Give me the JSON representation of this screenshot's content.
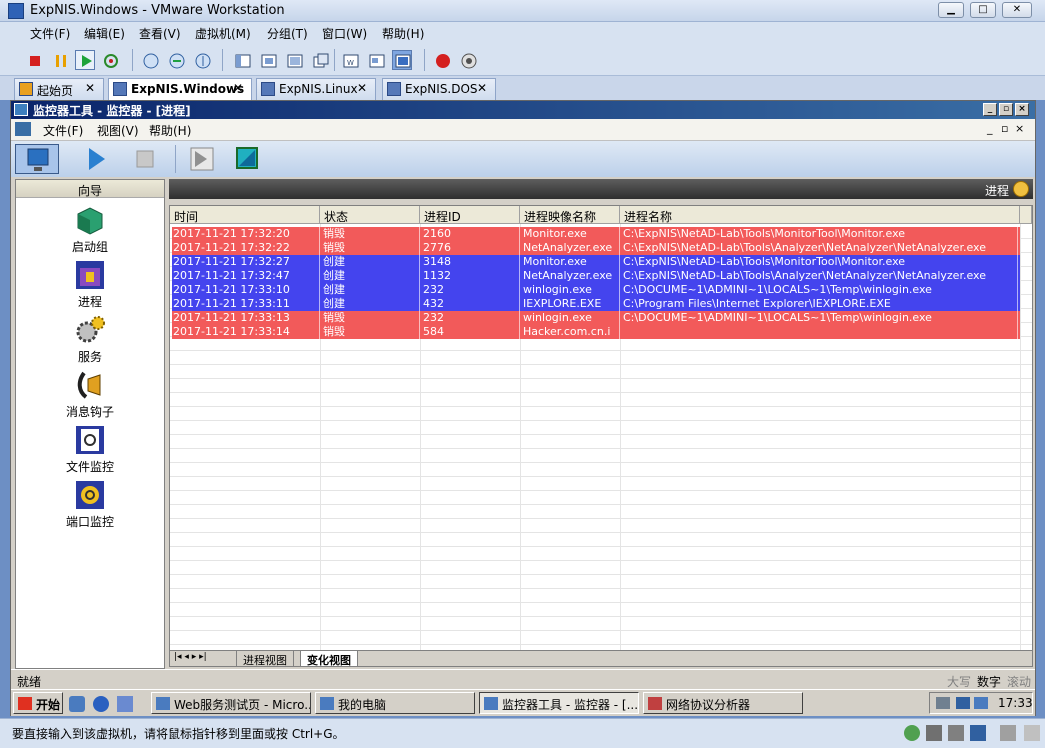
{
  "vm": {
    "title": "ExpNIS.Windows - VMware Workstation",
    "menu": [
      "文件(F)",
      "编辑(E)",
      "查看(V)",
      "虚拟机(M)",
      "分组(T)",
      "窗口(W)",
      "帮助(H)"
    ],
    "tabs": [
      {
        "label": "起始页",
        "active": false
      },
      {
        "label": "ExpNIS.Windows",
        "active": true
      },
      {
        "label": "ExpNIS.Linux",
        "active": false
      },
      {
        "label": "ExpNIS.DOS",
        "active": false
      }
    ],
    "status": "要直接输入到该虚拟机，请将鼠标指针移到里面或按 Ctrl+G。"
  },
  "app": {
    "title": "监控器工具 - 监控器 - [进程]",
    "menu": [
      "文件(F)",
      "视图(V)",
      "帮助(H)"
    ],
    "sidebar": {
      "header": "向导",
      "items": [
        "启动组",
        "进程",
        "服务",
        "消息钩子",
        "文件监控",
        "端口监控"
      ]
    },
    "panel_title": "进程",
    "columns": [
      "时间",
      "状态",
      "进程ID",
      "进程映像名称",
      "进程名称"
    ],
    "rows": [
      {
        "color": "r",
        "time": "2017-11-21 17:32:20",
        "status": "销毁",
        "pid": "2160",
        "image": "Monitor.exe",
        "path": "C:\\ExpNIS\\NetAD-Lab\\Tools\\MonitorTool\\Monitor.exe"
      },
      {
        "color": "r",
        "time": "2017-11-21 17:32:22",
        "status": "销毁",
        "pid": "2776",
        "image": "NetAnalyzer.exe",
        "path": "C:\\ExpNIS\\NetAD-Lab\\Tools\\Analyzer\\NetAnalyzer\\NetAnalyzer.exe"
      },
      {
        "color": "b",
        "time": "2017-11-21 17:32:27",
        "status": "创建",
        "pid": "3148",
        "image": "Monitor.exe",
        "path": "C:\\ExpNIS\\NetAD-Lab\\Tools\\MonitorTool\\Monitor.exe"
      },
      {
        "color": "b",
        "time": "2017-11-21 17:32:47",
        "status": "创建",
        "pid": "1132",
        "image": "NetAnalyzer.exe",
        "path": "C:\\ExpNIS\\NetAD-Lab\\Tools\\Analyzer\\NetAnalyzer\\NetAnalyzer.exe"
      },
      {
        "color": "b",
        "time": "2017-11-21 17:33:10",
        "status": "创建",
        "pid": "232",
        "image": "winlogin.exe",
        "path": "C:\\DOCUME~1\\ADMINI~1\\LOCALS~1\\Temp\\winlogin.exe"
      },
      {
        "color": "b",
        "time": "2017-11-21 17:33:11",
        "status": "创建",
        "pid": "432",
        "image": "IEXPLORE.EXE",
        "path": "C:\\Program Files\\Internet Explorer\\IEXPLORE.EXE"
      },
      {
        "color": "r",
        "time": "2017-11-21 17:33:13",
        "status": "销毁",
        "pid": "232",
        "image": "winlogin.exe",
        "path": "C:\\DOCUME~1\\ADMINI~1\\LOCALS~1\\Temp\\winlogin.exe"
      },
      {
        "color": "r",
        "time": "2017-11-21 17:33:14",
        "status": "销毁",
        "pid": "584",
        "image": "Hacker.com.cn.i",
        "path": ""
      }
    ],
    "sheet_tabs": [
      "进程视图",
      "变化视图"
    ],
    "active_sheet": "变化视图",
    "status": "就绪",
    "indicators": [
      "大写",
      "数字",
      "滚动"
    ]
  },
  "taskbar": {
    "start": "开始",
    "buttons": [
      "Web服务测试页 - Micro...",
      "我的电脑",
      "监控器工具 - 监控器 - [...",
      "网络协议分析器"
    ],
    "clock": "17:33"
  },
  "colors": {
    "destroy_row": "#f25a5a",
    "create_row": "#4444ee"
  }
}
